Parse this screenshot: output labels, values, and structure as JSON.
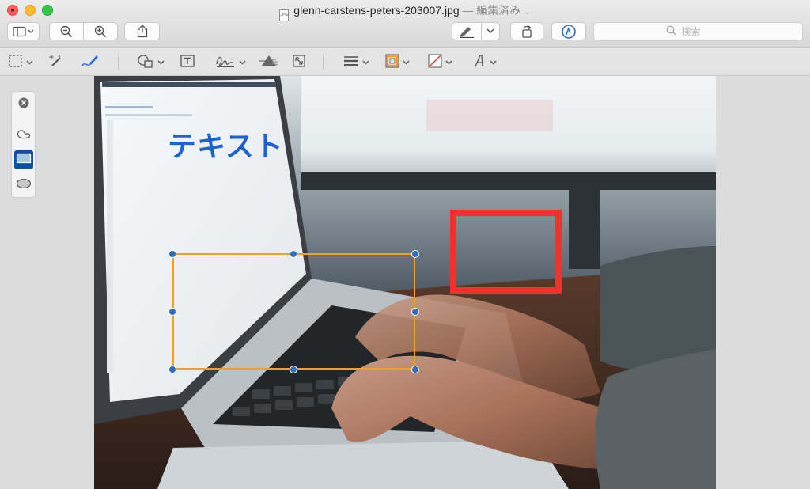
{
  "window": {
    "file_icon_text": "JPG",
    "title": "glenn-carstens-peters-203007.jpg",
    "edited_label": "— 編集済み",
    "title_chevron": "⌄"
  },
  "toolbar": {
    "search_placeholder": "検索",
    "buttons": [
      "sidebar-toggle",
      "zoom-out",
      "zoom-in",
      "share",
      "highlight",
      "rotate",
      "markup"
    ]
  },
  "markup_toolbar": {
    "tools": [
      "rectangular-selection",
      "instant-alpha",
      "sketch",
      "shapes",
      "text",
      "sign",
      "adjust-color",
      "adjust-size",
      "shape-style",
      "border-color",
      "fill-color",
      "text-style"
    ],
    "border_color": "#f0a02a",
    "fill_color": "none"
  },
  "shape_palette": {
    "items": [
      "close",
      "freeform-shape",
      "rectangle",
      "oval"
    ],
    "selected": "rectangle",
    "selected_color": "#0f4f9e"
  },
  "annotations": {
    "text": "テキスト",
    "text_color": "#1b62d6",
    "red_rect_color": "#f3312a",
    "selected_rect_color": "#f0a02a",
    "handle_color": "#2c6cc4"
  }
}
